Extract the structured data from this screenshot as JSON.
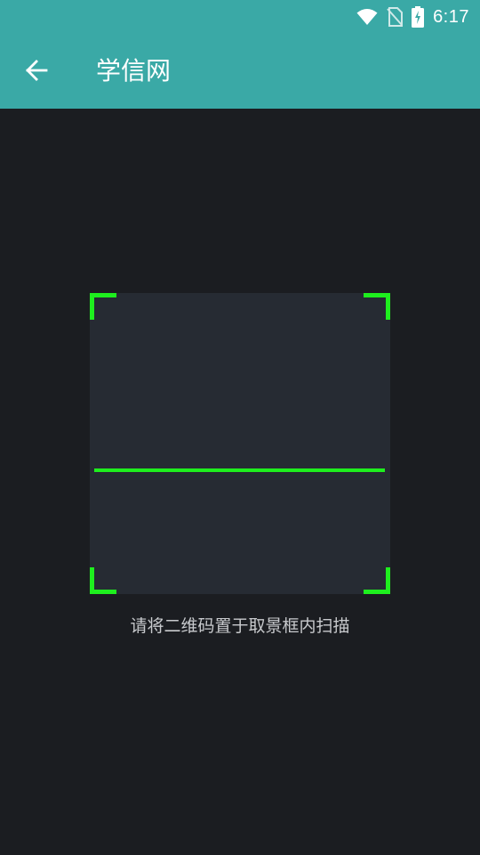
{
  "status_bar": {
    "time": "6:17",
    "icons": [
      "wifi-icon",
      "no-sim-icon",
      "battery-charging-icon"
    ]
  },
  "app_bar": {
    "back_icon": "arrow-left-icon",
    "title": "学信网",
    "background_color": "#3aa9a6"
  },
  "scanner": {
    "hint": "请将二维码置于取景框内扫描",
    "accent_color": "#1eef1e",
    "frame_color": "#262b33",
    "background_color": "#1b1d21"
  }
}
